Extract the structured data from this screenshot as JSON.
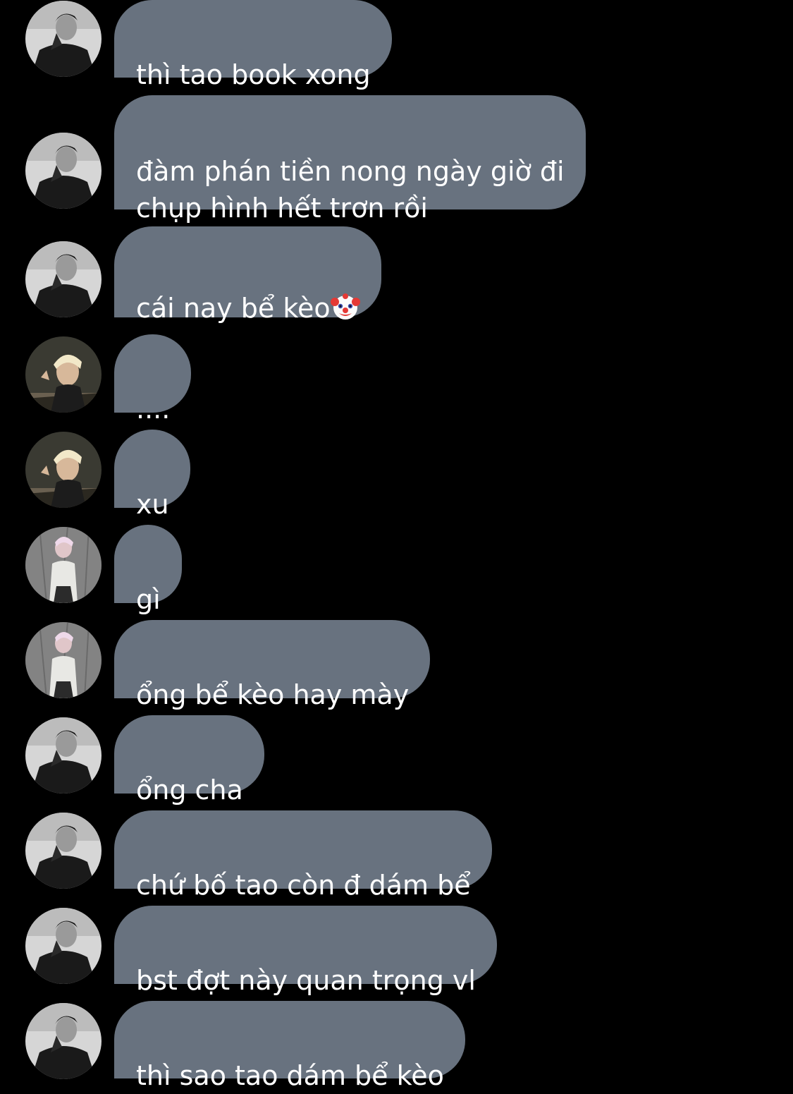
{
  "colors": {
    "background": "#000000",
    "bubble": "#68727f",
    "text": "#ffffff"
  },
  "messages": [
    {
      "sender_avatar": "dark-monochrome-avatar",
      "text": "thì tao book xong"
    },
    {
      "sender_avatar": "dark-monochrome-avatar",
      "text": "đàm phán tiền nong ngày giờ đi\nchụp hình hết trơn rồi"
    },
    {
      "sender_avatar": "dark-monochrome-avatar",
      "text": "cái nay bể kèo",
      "emoji": "clown-face-emoji"
    },
    {
      "sender_avatar": "blond-hair-avatar",
      "text": "...."
    },
    {
      "sender_avatar": "blond-hair-avatar",
      "text": "xu"
    },
    {
      "sender_avatar": "pink-hair-avatar",
      "text": "gì"
    },
    {
      "sender_avatar": "pink-hair-avatar",
      "text": "ổng bể kèo hay mày"
    },
    {
      "sender_avatar": "dark-monochrome-avatar",
      "text": "ổng cha"
    },
    {
      "sender_avatar": "dark-monochrome-avatar",
      "text": "chứ bố tao còn đ dám bể"
    },
    {
      "sender_avatar": "dark-monochrome-avatar",
      "text": "bst đợt này quan trọng vl"
    },
    {
      "sender_avatar": "dark-monochrome-avatar",
      "text": "thì sao tao dám bể kèo"
    }
  ]
}
